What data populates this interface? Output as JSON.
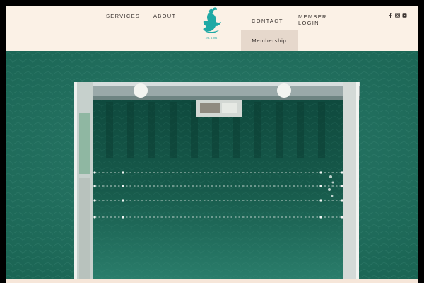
{
  "nav": {
    "services": "SERVICES",
    "about": "ABOUT",
    "contact": "CONTACT",
    "member_login_line1": "MEMBER",
    "member_login_line2": "LOGIN",
    "dropdown_membership": "Membership"
  },
  "logo": {
    "established": "Est. 1881"
  },
  "social": [
    "facebook-icon",
    "instagram-icon",
    "youtube-icon"
  ],
  "colors": {
    "header_bg": "#fbf1e6",
    "dropdown_bg": "#e6d8cc",
    "logo_teal": "#1fa9a5",
    "water": "#1f6e5e"
  }
}
